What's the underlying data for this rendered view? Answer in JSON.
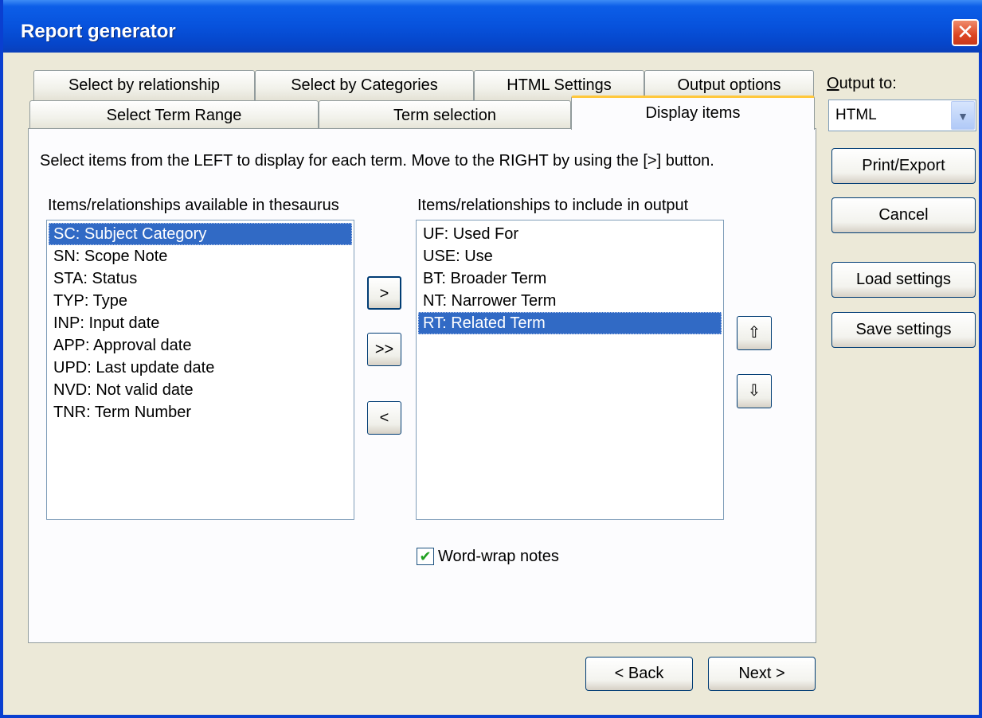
{
  "window": {
    "title": "Report generator",
    "close_glyph": "✕"
  },
  "tabs": {
    "row1": [
      {
        "label": "Select by relationship"
      },
      {
        "label": "Select by Categories"
      },
      {
        "label": "HTML Settings"
      },
      {
        "label": "Output options"
      }
    ],
    "row2": [
      {
        "label": "Select Term Range"
      },
      {
        "label": "Term selection"
      },
      {
        "label": "Display items",
        "active": true
      }
    ]
  },
  "panel": {
    "instructions": "Select items from the LEFT to display for each term.  Move to the RIGHT by using the [>] button.",
    "available_label": "Items/relationships available in thesaurus",
    "included_label": "Items/relationships to include in output",
    "available_items": [
      "SC: Subject Category",
      "SN: Scope Note",
      "STA: Status",
      "TYP: Type",
      "INP: Input date",
      "APP: Approval date",
      "UPD: Last update date",
      "NVD: Not valid date",
      "TNR: Term Number"
    ],
    "available_selected_index": 0,
    "included_items": [
      "UF: Used For",
      "USE: Use",
      "BT: Broader Term",
      "NT: Narrower Term",
      "RT: Related Term"
    ],
    "included_selected_index": 4,
    "move_buttons": {
      "add": ">",
      "add_all": ">>",
      "remove": "<"
    },
    "order_buttons": {
      "up": "⇧",
      "down": "⇩"
    },
    "wordwrap": {
      "label": "Word-wrap notes",
      "checked": true,
      "check_glyph": "✔"
    }
  },
  "right_panel": {
    "output_to_label": "Output to:",
    "output_to_value": "HTML",
    "dropdown_arrow": "▼",
    "print_export": "Print/Export",
    "cancel": "Cancel",
    "load_settings": "Load settings",
    "save_settings": "Save settings"
  },
  "nav": {
    "back": "< Back",
    "next": "Next >"
  },
  "colors": {
    "selection": "#316ac5",
    "titlebar": "#0752dc",
    "dialog_bg": "#ece9d8",
    "active_tab_accent": "#ffc83c",
    "check": "#21a121"
  }
}
